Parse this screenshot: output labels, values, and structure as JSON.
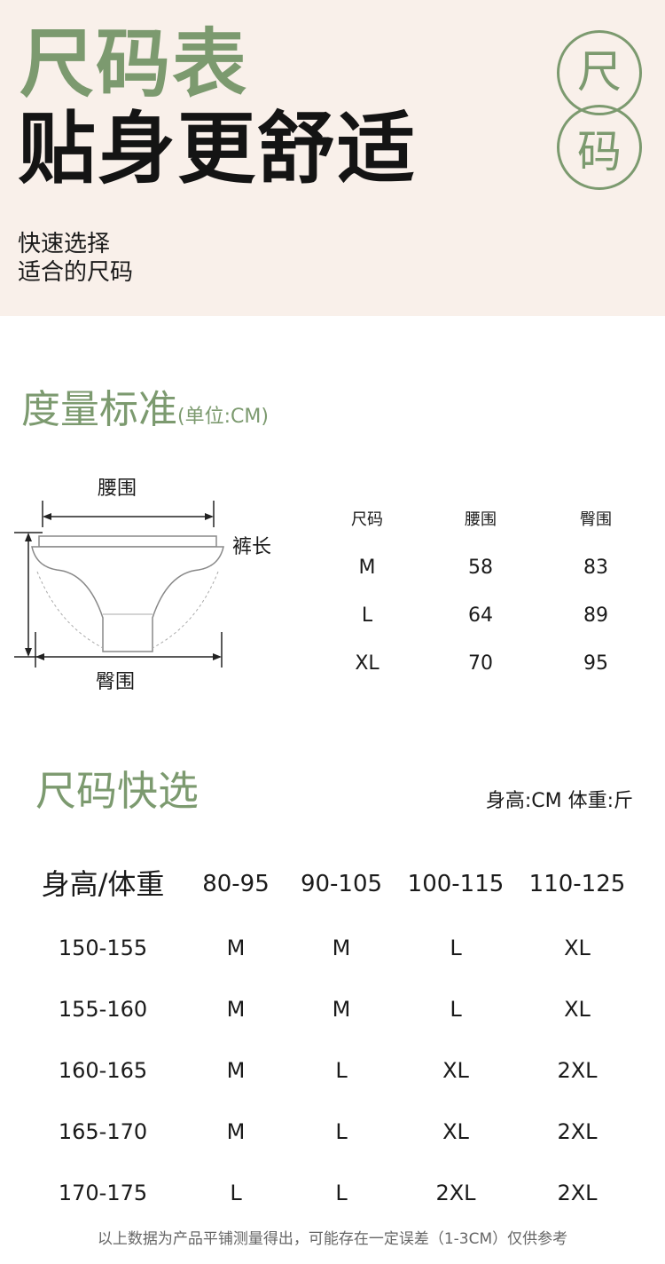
{
  "header": {
    "title_line1": "尺码表",
    "title_line2": "贴身更舒适",
    "subtitle_line1": "快速选择",
    "subtitle_line2": "适合的尺码",
    "badge_chars": [
      "尺",
      "码"
    ],
    "background_color": "#f9f0ea",
    "accent_color": "#7c9a6f"
  },
  "measure": {
    "title": "度量标准",
    "unit_note": "(单位:CM)",
    "diagram_labels": {
      "waist": "腰围",
      "length": "裤长",
      "hip": "臀围"
    },
    "table": {
      "headers": [
        "尺码",
        "腰围",
        "臀围"
      ],
      "rows": [
        [
          "M",
          "58",
          "83"
        ],
        [
          "L",
          "64",
          "89"
        ],
        [
          "XL",
          "70",
          "95"
        ]
      ]
    }
  },
  "quick": {
    "title": "尺码快选",
    "note": "身高:CM 体重:斤",
    "headers": [
      "身高/体重",
      "80-95",
      "90-105",
      "100-115",
      "110-125"
    ],
    "rows": [
      [
        "150-155",
        "M",
        "M",
        "L",
        "XL"
      ],
      [
        "155-160",
        "M",
        "M",
        "L",
        "XL"
      ],
      [
        "160-165",
        "M",
        "L",
        "XL",
        "2XL"
      ],
      [
        "165-170",
        "M",
        "L",
        "XL",
        "2XL"
      ],
      [
        "170-175",
        "L",
        "L",
        "2XL",
        "2XL"
      ]
    ]
  },
  "footer": {
    "note": "以上数据为产品平铺测量得出，可能存在一定误差（1-3CM）仅供参考"
  }
}
